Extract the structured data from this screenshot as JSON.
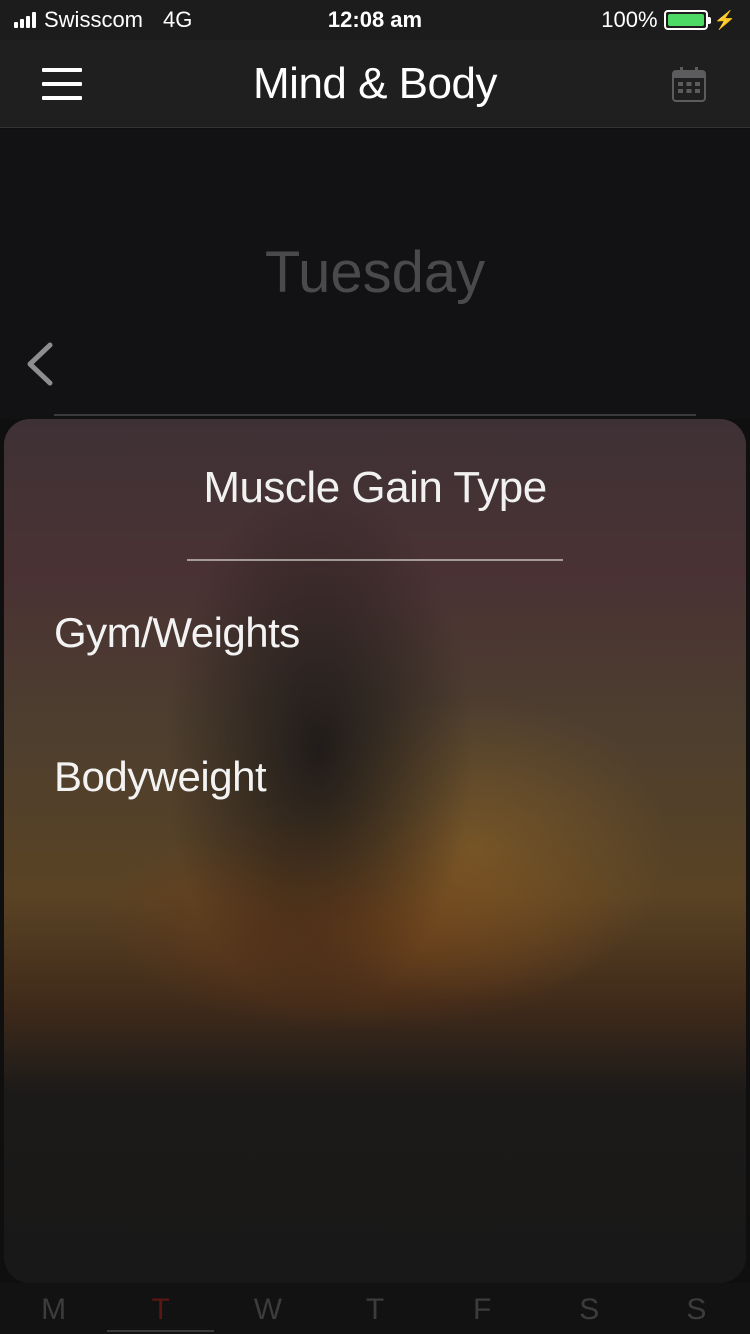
{
  "status_bar": {
    "carrier": "Swisscom",
    "network": "4G",
    "time": "12:08 am",
    "battery_percent": "100%",
    "battery_level": 1.0,
    "battery_color": "#4cd964"
  },
  "nav": {
    "title": "Mind & Body",
    "left_icon": "hamburger-menu-icon",
    "right_icon": "calendar-icon"
  },
  "day": {
    "title": "Tuesday",
    "back_icon": "chevron-left-icon"
  },
  "sheet": {
    "title": "Muscle Gain Type",
    "options": [
      {
        "label": "Gym/Weights"
      },
      {
        "label": "Bodyweight"
      }
    ]
  },
  "weekdays": {
    "items": [
      {
        "label": "M"
      },
      {
        "label": "T"
      },
      {
        "label": "W"
      },
      {
        "label": "T"
      },
      {
        "label": "F"
      },
      {
        "label": "S"
      },
      {
        "label": "S"
      }
    ],
    "active_color": "#5a1713"
  }
}
